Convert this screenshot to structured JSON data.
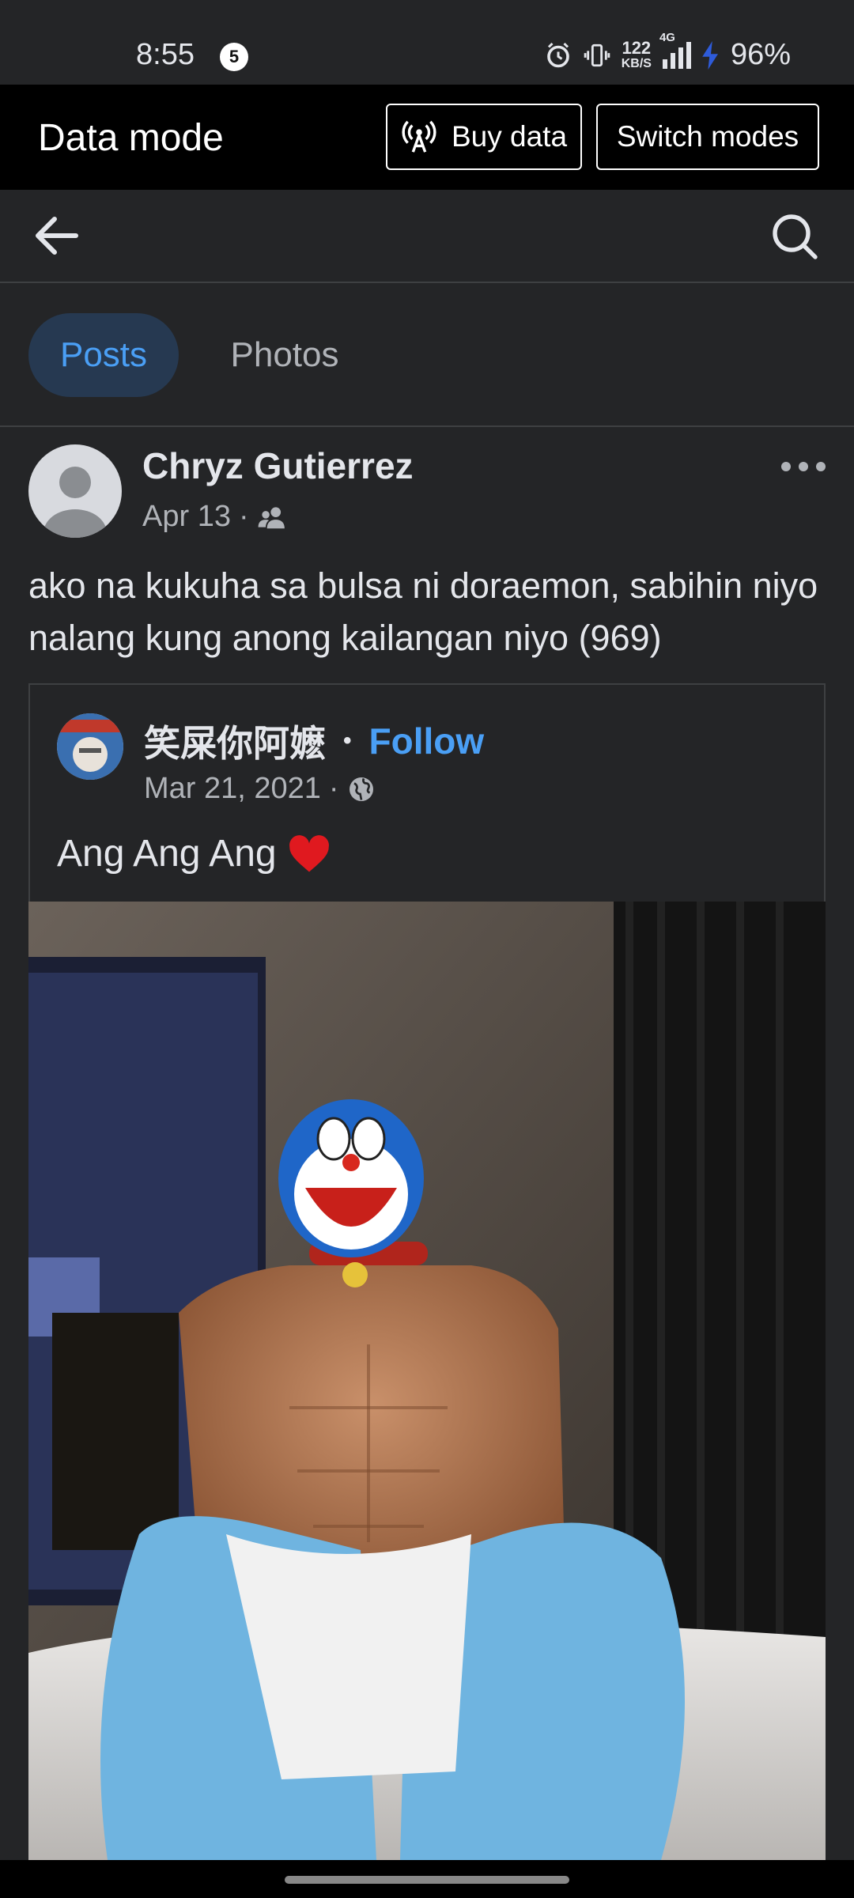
{
  "status_bar": {
    "time": "8:55",
    "notification_count": "5",
    "speed_value": "122",
    "speed_unit": "KB/S",
    "network": "4G",
    "battery": "96%"
  },
  "data_mode": {
    "title": "Data mode",
    "buy_label": "Buy data",
    "switch_label": "Switch modes"
  },
  "tabs": [
    {
      "label": "Posts",
      "active": true
    },
    {
      "label": "Photos",
      "active": false
    }
  ],
  "post": {
    "author": "Chryz Gutierrez",
    "date": "Apr 13",
    "separator": "·",
    "audience_icon": "friends-icon",
    "caption": "ako na kukuha sa bulsa ni doraemon, sabihin niyo nalang kung anong kailangan niyo (969)",
    "shared": {
      "author": "笑屎你阿嬷",
      "dot": "•",
      "follow_label": "Follow",
      "date": "Mar 21, 2021",
      "separator": "·",
      "audience_icon": "globe-icon",
      "text": "Ang Ang Ang",
      "emoji": "❤️"
    },
    "photo_icon": "shared-photo"
  },
  "colors": {
    "background": "#242527",
    "accent": "#4a9ff5",
    "active_tab_bg": "#263951",
    "divider": "#3e4042"
  }
}
